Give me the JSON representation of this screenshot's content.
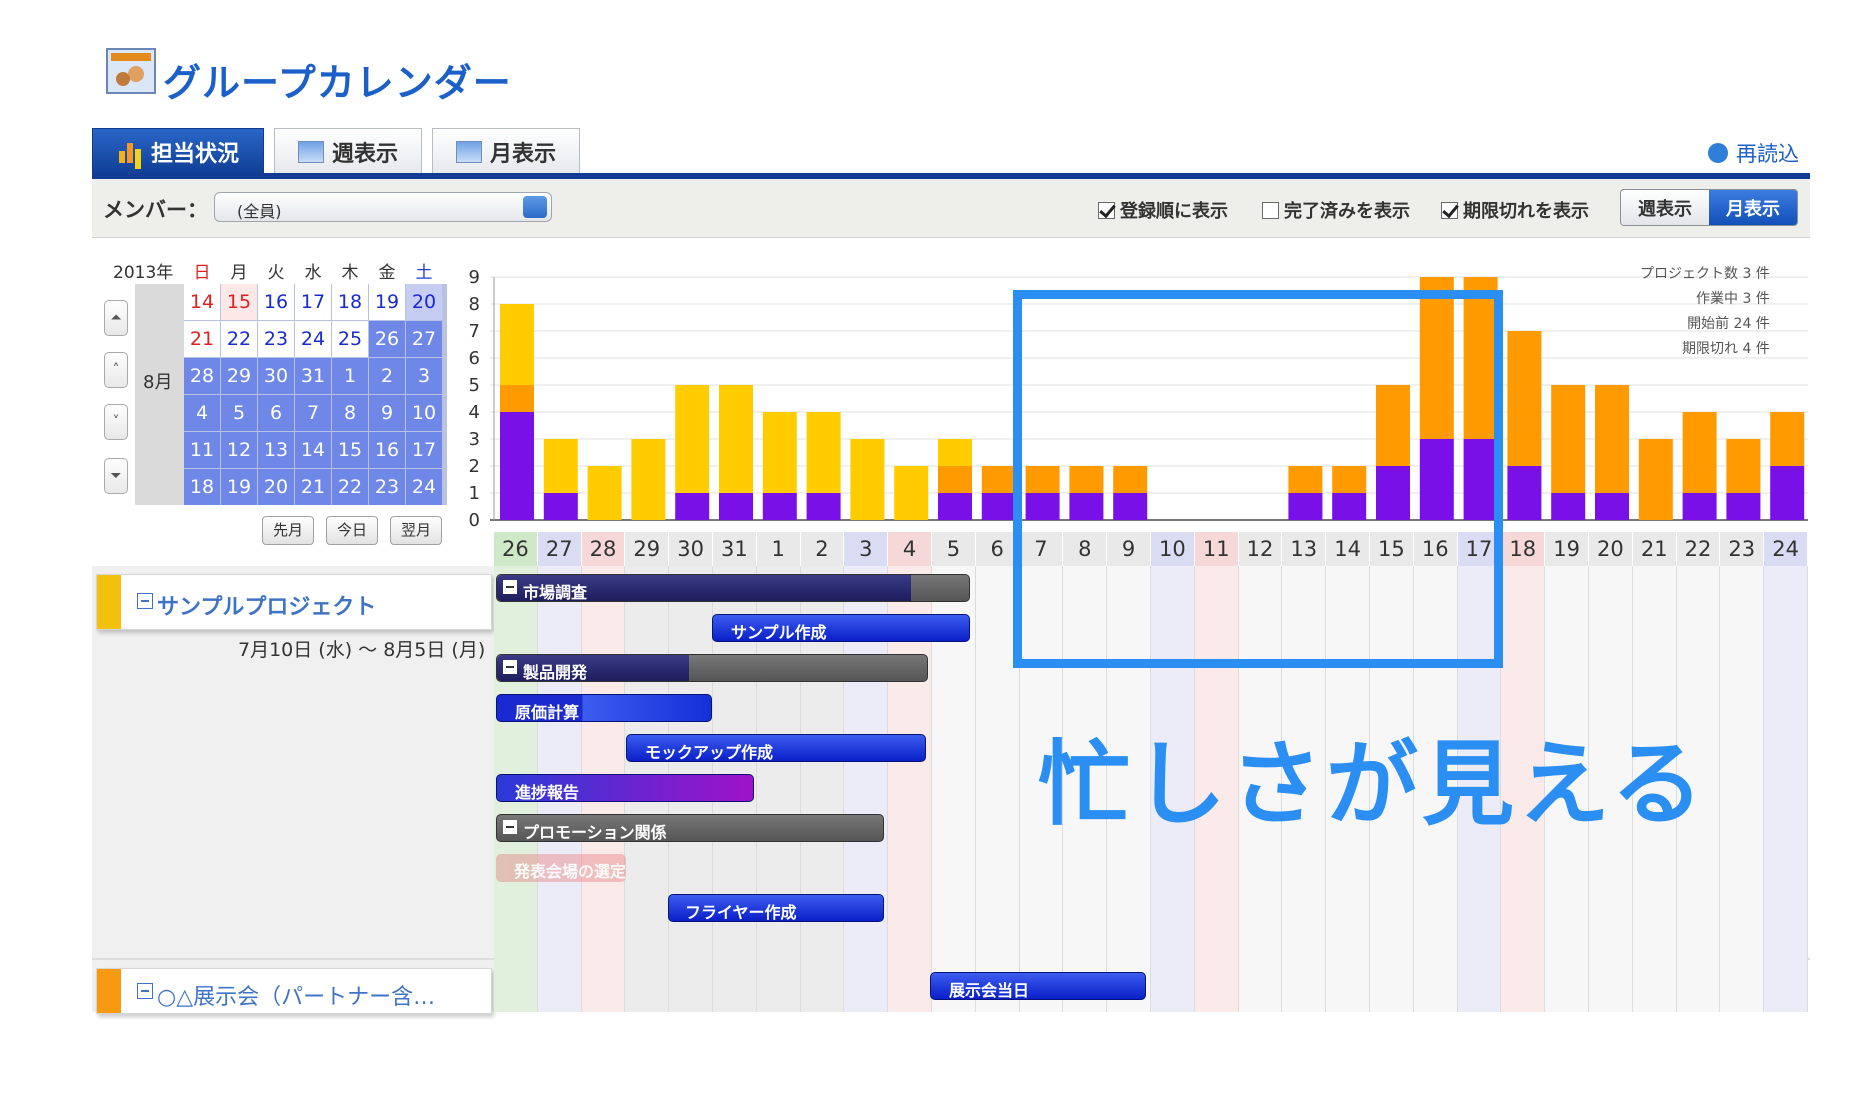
{
  "app": {
    "title": "グループカレンダー"
  },
  "tabs": [
    {
      "label": "担当状況",
      "active": true
    },
    {
      "label": "週表示",
      "active": false
    },
    {
      "label": "月表示",
      "active": false
    }
  ],
  "reload_label": "再読込",
  "filter": {
    "member_label": "メンバー：",
    "member_value": "(全員)",
    "checkboxes": [
      {
        "label": "登録順に表示",
        "checked": true
      },
      {
        "label": "完了済みを表示",
        "checked": false
      },
      {
        "label": "期限切れを表示",
        "checked": true
      }
    ],
    "view_toggle": [
      {
        "label": "週表示",
        "active": false
      },
      {
        "label": "月表示",
        "active": true
      }
    ]
  },
  "mini_calendar": {
    "year": "2013年",
    "dow": [
      "日",
      "月",
      "火",
      "水",
      "木",
      "金",
      "土"
    ],
    "month_label": "8月",
    "weeks": [
      [
        "14",
        "15",
        "16",
        "17",
        "18",
        "19",
        "20"
      ],
      [
        "21",
        "22",
        "23",
        "24",
        "25",
        "26",
        "27"
      ],
      [
        "28",
        "29",
        "30",
        "31",
        "1",
        "2",
        "3"
      ],
      [
        "4",
        "5",
        "6",
        "7",
        "8",
        "9",
        "10"
      ],
      [
        "11",
        "12",
        "13",
        "14",
        "15",
        "16",
        "17"
      ],
      [
        "18",
        "19",
        "20",
        "21",
        "22",
        "23",
        "24"
      ]
    ],
    "buttons": [
      "先月",
      "今日",
      "翌月"
    ]
  },
  "legend": [
    "プロジェクト数 3 件",
    "作業中 3 件",
    "開始前 24 件",
    "期限切れ 4 件"
  ],
  "colors": {
    "purple": "#7a10e8",
    "orange": "#ff9a00",
    "yellow": "#ffcc00",
    "highlight": "#2a8ef2",
    "tab_active": "#1a4fa8"
  },
  "chart_data": {
    "type": "bar",
    "stacked": true,
    "categories": [
      "26",
      "27",
      "28",
      "29",
      "30",
      "31",
      "1",
      "2",
      "3",
      "4",
      "5",
      "6",
      "7",
      "8",
      "9",
      "10",
      "11",
      "12",
      "13",
      "14",
      "15",
      "16",
      "17",
      "18",
      "19",
      "20",
      "21",
      "22",
      "23",
      "24"
    ],
    "ylim": [
      0,
      9
    ],
    "yticks": [
      0,
      1,
      2,
      3,
      4,
      5,
      6,
      7,
      8,
      9
    ],
    "series": [
      {
        "color": "#7a10e8",
        "values": [
          4,
          1,
          0,
          0,
          1,
          1,
          1,
          1,
          0,
          0,
          1,
          1,
          1,
          1,
          1,
          0,
          0,
          0,
          1,
          1,
          2,
          3,
          3,
          2,
          1,
          1,
          0,
          1,
          1,
          2
        ]
      },
      {
        "color": "#ff9a00",
        "values": [
          1,
          0,
          0,
          0,
          0,
          0,
          0,
          0,
          0,
          0,
          1,
          1,
          1,
          1,
          1,
          0,
          0,
          0,
          1,
          1,
          3,
          6,
          6,
          5,
          4,
          4,
          3,
          3,
          2,
          2
        ]
      },
      {
        "color": "#ffcc00",
        "values": [
          3,
          2,
          2,
          3,
          4,
          4,
          3,
          3,
          3,
          2,
          1,
          0,
          0,
          0,
          0,
          0,
          0,
          0,
          0,
          0,
          0,
          0,
          0,
          0,
          0,
          0,
          0,
          0,
          0,
          0
        ]
      }
    ]
  },
  "gantt": {
    "projects": [
      {
        "name": "サンプルプロジェクト",
        "dates": "7月10日 (水) 〜 8月5日 (月)"
      },
      {
        "name": "○△展示会（パートナー含…"
      }
    ],
    "tasks": {
      "market": "市場調査",
      "sample": "サンプル作成",
      "product": "製品開発",
      "cost": "原価計算",
      "mockup": "モックアップ作成",
      "progress": "進捗報告",
      "promo": "プロモーション関係",
      "venue": "発表会場の選定",
      "flyer": "フライヤー作成",
      "expo_day": "展示会当日"
    }
  },
  "overlay": {
    "caption": "忙しさが見える"
  }
}
